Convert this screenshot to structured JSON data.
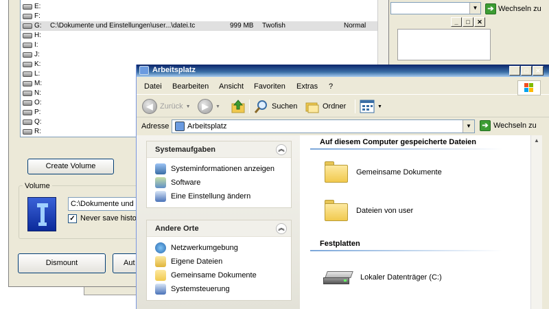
{
  "truecrypt": {
    "drives": [
      {
        "letter": "E:",
        "volume": "",
        "size": "",
        "encryption": "",
        "type": ""
      },
      {
        "letter": "F:",
        "volume": "",
        "size": "",
        "encryption": "",
        "type": ""
      },
      {
        "letter": "G:",
        "volume": "C:\\Dokumente und Einstellungen\\user...\\datei.tc",
        "size": "999 MB",
        "encryption": "Twofish",
        "type": "Normal",
        "selected": true
      },
      {
        "letter": "H:",
        "volume": "",
        "size": "",
        "encryption": "",
        "type": ""
      },
      {
        "letter": "I:",
        "volume": "",
        "size": "",
        "encryption": "",
        "type": ""
      },
      {
        "letter": "J:",
        "volume": "",
        "size": "",
        "encryption": "",
        "type": ""
      },
      {
        "letter": "K:",
        "volume": "",
        "size": "",
        "encryption": "",
        "type": ""
      },
      {
        "letter": "L:",
        "volume": "",
        "size": "",
        "encryption": "",
        "type": ""
      },
      {
        "letter": "M:",
        "volume": "",
        "size": "",
        "encryption": "",
        "type": ""
      },
      {
        "letter": "N:",
        "volume": "",
        "size": "",
        "encryption": "",
        "type": ""
      },
      {
        "letter": "O:",
        "volume": "",
        "size": "",
        "encryption": "",
        "type": ""
      },
      {
        "letter": "P:",
        "volume": "",
        "size": "",
        "encryption": "",
        "type": ""
      },
      {
        "letter": "Q:",
        "volume": "",
        "size": "",
        "encryption": "",
        "type": ""
      },
      {
        "letter": "R:",
        "volume": "",
        "size": "",
        "encryption": "",
        "type": ""
      }
    ],
    "create_volume_label": "Create Volume",
    "volume_group_label": "Volume",
    "volume_path": "C:\\Dokumente und",
    "never_save_label": "Never save histo",
    "never_save_checked": true,
    "dismount_label": "Dismount",
    "auto_label": "Aut"
  },
  "background_explorer": {
    "goto_label": "Wechseln zu",
    "title_buttons": [
      "_",
      "□",
      "✕"
    ]
  },
  "arbeitsplatz": {
    "title": "Arbeitsplatz",
    "title_buttons": [
      "_",
      "□",
      "✕"
    ],
    "menu": [
      "Datei",
      "Bearbeiten",
      "Ansicht",
      "Favoriten",
      "Extras",
      "?"
    ],
    "toolbar": {
      "back_label": "Zurück",
      "search_label": "Suchen",
      "folders_label": "Ordner"
    },
    "address": {
      "label": "Adresse",
      "value": "Arbeitsplatz",
      "goto_label": "Wechseln zu"
    },
    "system_tasks": {
      "title": "Systemaufgaben",
      "items": [
        {
          "label": "Systeminformationen anzeigen",
          "icon": "system-info-icon"
        },
        {
          "label": "Software",
          "icon": "software-icon"
        },
        {
          "label": "Eine Einstellung ändern",
          "icon": "settings-change-icon"
        }
      ]
    },
    "other_places": {
      "title": "Andere Orte",
      "items": [
        {
          "label": "Netzwerkumgebung",
          "icon": "network-icon"
        },
        {
          "label": "Eigene Dateien",
          "icon": "my-documents-icon"
        },
        {
          "label": "Gemeinsame Dokumente",
          "icon": "shared-documents-icon"
        },
        {
          "label": "Systemsteuerung",
          "icon": "control-panel-icon"
        }
      ]
    },
    "content": {
      "stored_files_title": "Auf diesem Computer gespeicherte Dateien",
      "stored_files": [
        "Gemeinsame Dokumente",
        "Dateien von user"
      ],
      "hard_disks_title": "Festplatten",
      "hard_disks": [
        "Lokaler Datenträger (C:)"
      ]
    }
  }
}
